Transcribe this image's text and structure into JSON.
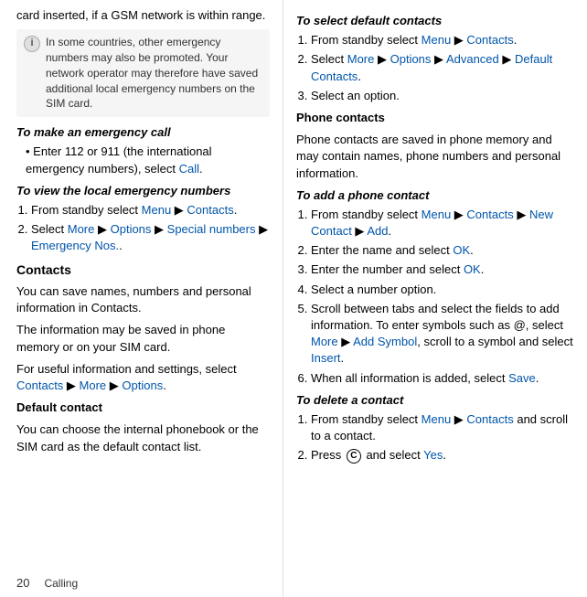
{
  "left": {
    "intro_text": "card inserted, if a GSM network is within range.",
    "note": "In some countries, other emergency numbers may also be promoted. Your network operator may therefore have saved additional local emergency numbers on the SIM card.",
    "emergency_call_heading": "To make an emergency call",
    "emergency_call_bullet": "Enter 112 or 911 (the international emergency numbers), select ",
    "emergency_call_link": "Call",
    "local_numbers_heading": "To view the local emergency numbers",
    "local_step1": "From standby select ",
    "local_step1_link1": "Menu",
    "local_step1_mid": " ▶ ",
    "local_step1_link2": "Contacts",
    "local_step1_end": ".",
    "local_step2": "Select ",
    "local_step2_link1": "More",
    "local_step2_mid1": " ▶ ",
    "local_step2_link2": "Options",
    "local_step2_mid2": " ▶ ",
    "local_step2_link3": "Special numbers",
    "local_step2_mid3": " ▶ ",
    "local_step2_link4": "Emergency Nos.",
    "local_step2_end": ".",
    "contacts_heading": "Contacts",
    "contacts_p1": "You can save names, numbers and personal information in Contacts.",
    "contacts_p2": "The information may be saved in phone memory or on your SIM card.",
    "contacts_p3_pre": "For useful information and settings, select ",
    "contacts_p3_link1": "Contacts",
    "contacts_p3_mid1": " ▶ ",
    "contacts_p3_link2": "More",
    "contacts_p3_mid2": " ▶ ",
    "contacts_p3_link3": "Options",
    "contacts_p3_end": ".",
    "default_contact_heading": "Default contact",
    "default_contact_text": "You can choose the internal phonebook or the SIM card as the default contact list.",
    "page_number": "20",
    "page_label": "Calling"
  },
  "right": {
    "select_default_heading": "To select default contacts",
    "select_step1": "From standby select ",
    "select_step1_link1": "Menu",
    "select_step1_mid": " ▶ ",
    "select_step1_link2": "Contacts",
    "select_step1_end": ".",
    "select_step2": "Select ",
    "select_step2_link1": "More",
    "select_step2_mid1": " ▶ ",
    "select_step2_link2": "Options",
    "select_step2_mid2": " ▶ ",
    "select_step2_link3": "Advanced",
    "select_step2_mid3": " ▶ ",
    "select_step2_link4": "Default Contacts",
    "select_step2_end": ".",
    "select_step3": "Select an option.",
    "phone_contacts_heading": "Phone contacts",
    "phone_contacts_text": "Phone contacts are saved in phone memory and may contain names, phone numbers and personal information.",
    "add_phone_heading": "To add a phone contact",
    "add_step1": "From standby select ",
    "add_step1_link1": "Menu",
    "add_step1_mid1": " ▶ ",
    "add_step1_link2": "Contacts",
    "add_step1_mid2": " ▶ ",
    "add_step1_link3": "New Contact",
    "add_step1_mid3": " ▶ ",
    "add_step1_link4": "Add",
    "add_step1_end": ".",
    "add_step2": "Enter the name and select ",
    "add_step2_link": "OK",
    "add_step2_end": ".",
    "add_step3": "Enter the number and select ",
    "add_step3_link": "OK",
    "add_step3_end": ".",
    "add_step4": "Select a number option.",
    "add_step5_pre": "Scroll between tabs and select the fields to add information. To enter symbols such as @, select ",
    "add_step5_link1": "More",
    "add_step5_mid": " ▶ ",
    "add_step5_link2": "Add Symbol",
    "add_step5_post": ", scroll to a symbol and select ",
    "add_step5_link3": "Insert",
    "add_step5_end": ".",
    "add_step6": "When all information is added, select ",
    "add_step6_link": "Save",
    "add_step6_end": ".",
    "delete_heading": "To delete a contact",
    "delete_step1": "From standby select ",
    "delete_step1_link1": "Menu",
    "delete_step1_mid": " ▶ ",
    "delete_step1_link2": "Contacts",
    "delete_step1_post": " and scroll to a contact.",
    "delete_step2_pre": "Press ",
    "delete_step2_circle": "C",
    "delete_step2_post": " and select ",
    "delete_step2_link": "Yes",
    "delete_step2_end": "."
  }
}
